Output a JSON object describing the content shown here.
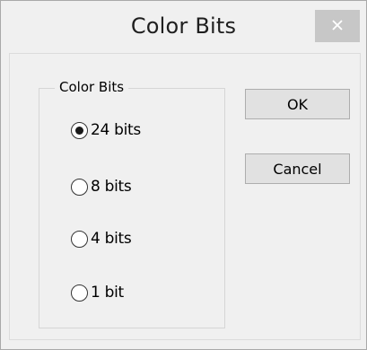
{
  "window": {
    "title": "Color Bits",
    "close_glyph": "×"
  },
  "group": {
    "label": "Color Bits",
    "options": [
      {
        "label": "24 bits",
        "selected": true
      },
      {
        "label": "8 bits",
        "selected": false
      },
      {
        "label": "4 bits",
        "selected": false
      },
      {
        "label": "1 bit",
        "selected": false
      }
    ]
  },
  "buttons": {
    "ok_label": "OK",
    "cancel_label": "Cancel"
  },
  "colors": {
    "window_bg": "#f0f0f0",
    "close_button_bg": "#c7c7c7",
    "button_bg": "#e1e1e1"
  }
}
